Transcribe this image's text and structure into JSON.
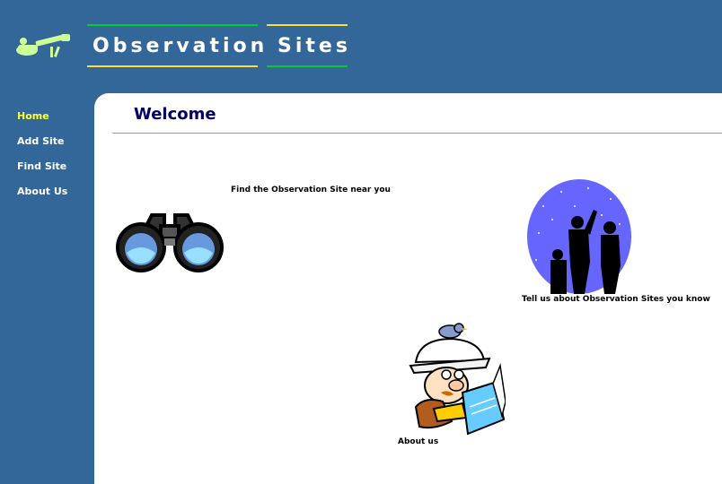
{
  "site": {
    "title_word1": "Observation",
    "title_word2": "Sites"
  },
  "nav": {
    "items": [
      {
        "label": "Home"
      },
      {
        "label": "Add Site"
      },
      {
        "label": "Find Site"
      },
      {
        "label": "About Us"
      }
    ]
  },
  "main": {
    "heading": "Welcome",
    "find_caption": "Find the Observation Site near you",
    "tell_caption": "Tell us about Observation Sites you know",
    "about_caption": "About us"
  },
  "colors": {
    "background": "#336699",
    "nav_active": "#ffff33",
    "heading": "#000066",
    "accent_green": "#00cc33",
    "accent_yellow": "#ffdd33"
  },
  "icons": [
    "telescope-logo-icon",
    "binoculars-icon",
    "stargazers-icon",
    "explorer-icon"
  ]
}
